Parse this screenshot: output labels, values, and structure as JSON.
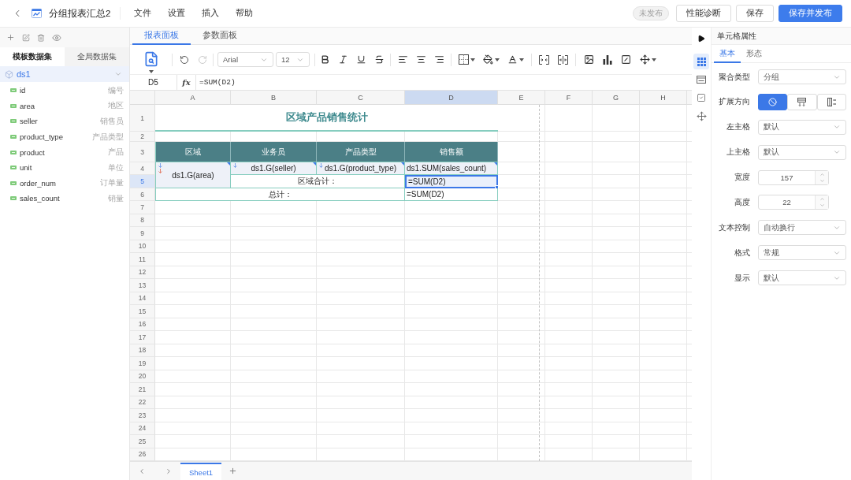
{
  "top_bar": {
    "title": "分组报表汇总2",
    "menus": [
      "文件",
      "设置",
      "插入",
      "帮助"
    ],
    "status": "未发布",
    "buttons": [
      {
        "label": "性能诊断",
        "kind": "default"
      },
      {
        "label": "保存",
        "kind": "default"
      },
      {
        "label": "保存并发布",
        "kind": "primary"
      }
    ]
  },
  "dataset_panel": {
    "tabs": [
      {
        "label": "模板数据集",
        "selected": true
      },
      {
        "label": "全局数据集",
        "selected": false
      }
    ],
    "datasets": [
      {
        "name": "ds1",
        "selected": true,
        "expanded": true,
        "fields": [
          {
            "name": "id",
            "label": "编号"
          },
          {
            "name": "area",
            "label": "地区"
          },
          {
            "name": "seller",
            "label": "销售员"
          },
          {
            "name": "product_type",
            "label": "产品类型"
          },
          {
            "name": "product",
            "label": "产品"
          },
          {
            "name": "unit",
            "label": "单位"
          },
          {
            "name": "order_num",
            "label": "订单量"
          },
          {
            "name": "sales_count",
            "label": "销量"
          }
        ]
      }
    ]
  },
  "editor": {
    "tabs": [
      {
        "label": "报表面板",
        "selected": true
      },
      {
        "label": "参数面板",
        "selected": false
      }
    ],
    "toolbar": {
      "history": [
        {
          "kind": "undo",
          "disabled": false
        },
        {
          "kind": "redo",
          "disabled": true
        }
      ],
      "font": "Arial",
      "font_size": "12"
    },
    "formula_bar": {
      "cell": "D5",
      "fx": "fx",
      "formula": "=SUM(D2)"
    }
  },
  "sheet": {
    "columns": [
      {
        "label": "A",
        "selected": false
      },
      {
        "label": "B",
        "selected": false
      },
      {
        "label": "C",
        "selected": false
      },
      {
        "label": "D",
        "selected": true
      },
      {
        "label": "E",
        "selected": false
      },
      {
        "label": "F",
        "selected": false
      },
      {
        "label": "G",
        "selected": false
      },
      {
        "label": "H",
        "selected": false
      }
    ],
    "rows": [
      {
        "label": "1",
        "selected": false
      },
      {
        "label": "2",
        "selected": false
      },
      {
        "label": "3",
        "selected": false
      },
      {
        "label": "4",
        "selected": false
      },
      {
        "label": "5",
        "selected": true
      },
      {
        "label": "6",
        "selected": false
      },
      {
        "label": "7",
        "selected": false
      },
      {
        "label": "8",
        "selected": false
      },
      {
        "label": "9",
        "selected": false
      },
      {
        "label": "10",
        "selected": false
      },
      {
        "label": "11",
        "selected": false
      },
      {
        "label": "12",
        "selected": false
      },
      {
        "label": "13",
        "selected": false
      },
      {
        "label": "14",
        "selected": false
      },
      {
        "label": "15",
        "selected": false
      },
      {
        "label": "16",
        "selected": false
      },
      {
        "label": "17",
        "selected": false
      },
      {
        "label": "18",
        "selected": false
      },
      {
        "label": "19",
        "selected": false
      },
      {
        "label": "20",
        "selected": false
      },
      {
        "label": "21",
        "selected": false
      },
      {
        "label": "22",
        "selected": false
      },
      {
        "label": "23",
        "selected": false
      },
      {
        "label": "24",
        "selected": false
      },
      {
        "label": "25",
        "selected": false
      },
      {
        "label": "26",
        "selected": false
      }
    ],
    "report": {
      "title": "区域产品销售统计",
      "headers": [
        "区域",
        "业务员",
        "产品类型",
        "销售额"
      ],
      "fields": [
        {
          "text": "ds1.G(area)",
          "expand_marker": true,
          "group_marker": true
        },
        {
          "text": "ds1.G(seller)",
          "expand_marker": true,
          "group_marker": false
        },
        {
          "text": "ds1.G(product_type)",
          "expand_marker": true,
          "group_marker": false
        },
        {
          "text": "ds1.SUM(sales_count)",
          "expand_marker": false,
          "group_marker": false
        }
      ],
      "subtotal": {
        "label": "区域合计：",
        "formula": "=SUM(D2)",
        "selected": true
      },
      "total": {
        "label": "总计：",
        "formula": "=SUM(D2)",
        "selected": false
      }
    },
    "tabs": [
      {
        "label": "Sheet1",
        "selected": true
      }
    ]
  },
  "side_tools": [
    {
      "kind": "cell",
      "selected": true
    },
    {
      "kind": "form",
      "selected": false
    },
    {
      "kind": "check",
      "selected": false
    },
    {
      "kind": "move",
      "selected": false
    }
  ],
  "properties_panel": {
    "title": "单元格属性",
    "tabs": [
      {
        "label": "基本",
        "selected": true
      },
      {
        "label": "形态",
        "selected": false
      }
    ],
    "fields": [
      {
        "kind": "select",
        "label": "聚合类型",
        "value": "分组"
      },
      {
        "kind": "segmented",
        "label": "扩展方向",
        "options": [
          {
            "kind": "none",
            "selected": true
          },
          {
            "kind": "vertical",
            "selected": false
          },
          {
            "kind": "horizontal",
            "selected": false
          }
        ]
      },
      {
        "kind": "select",
        "label": "左主格",
        "value": "默认"
      },
      {
        "kind": "select",
        "label": "上主格",
        "value": "默认"
      },
      {
        "kind": "number",
        "label": "宽度",
        "value": "157"
      },
      {
        "kind": "number",
        "label": "高度",
        "value": "22"
      },
      {
        "kind": "select",
        "label": "文本控制",
        "value": "自动换行"
      },
      {
        "kind": "select",
        "label": "格式",
        "value": "常规"
      },
      {
        "kind": "select",
        "label": "显示",
        "value": "默认"
      }
    ]
  }
}
